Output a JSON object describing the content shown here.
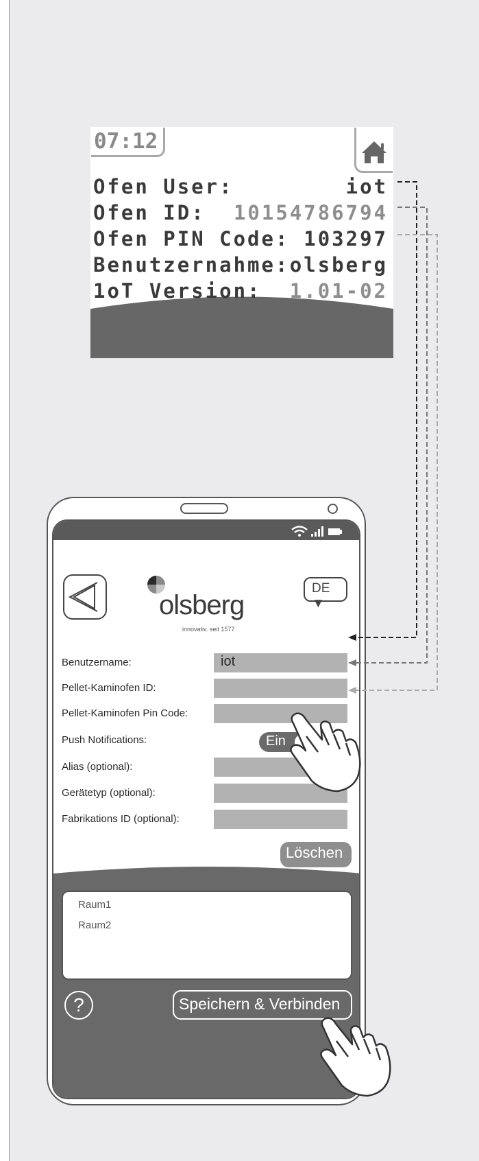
{
  "display": {
    "time": "07:12",
    "home_icon": "home-icon",
    "rows": [
      {
        "label": "Ofen User:",
        "value": "iot"
      },
      {
        "label": "Ofen ID:",
        "value": "10154786794"
      },
      {
        "label": "Ofen PIN Code:",
        "value": "103297"
      },
      {
        "label": "Benutzernahme:",
        "value": "olsberg"
      },
      {
        "label": "1oT Version:",
        "value": "1.01-02"
      }
    ]
  },
  "app": {
    "brand": "olsberg",
    "tagline": "innovativ. seit 1577",
    "language": "DE ▼",
    "status_icons": [
      "wifi-icon",
      "signal-icon",
      "battery-icon"
    ],
    "form": {
      "benutzername_label": "Benutzername:",
      "benutzername_value": "iot",
      "ofen_id_label": "Pellet-Kaminofen ID:",
      "ofen_id_value": "",
      "pin_label": "Pellet-Kaminofen Pin Code:",
      "pin_value": "",
      "push_label": "Push   Notifications:",
      "push_toggle": "Ein",
      "alias_label": "Alias (optional):",
      "alias_value": "",
      "geraetetyp_label": "Gerätetyp (optional):",
      "geraetetyp_value": "",
      "fabrikation_label": "Fabrikations ID (optional):",
      "fabrikation_value": ""
    },
    "delete_label": "Löschen",
    "rooms": [
      "Raum1",
      "Raum2"
    ],
    "help_label": "?",
    "save_label": "Speichern & Verbinden"
  },
  "colors": {
    "page_bg": "#ebebed",
    "dark_grey": "#5a5a5a",
    "input_grey": "#b2b2b2",
    "text_dark": "#3a3a3a",
    "text_grey": "#8e8e8e"
  }
}
